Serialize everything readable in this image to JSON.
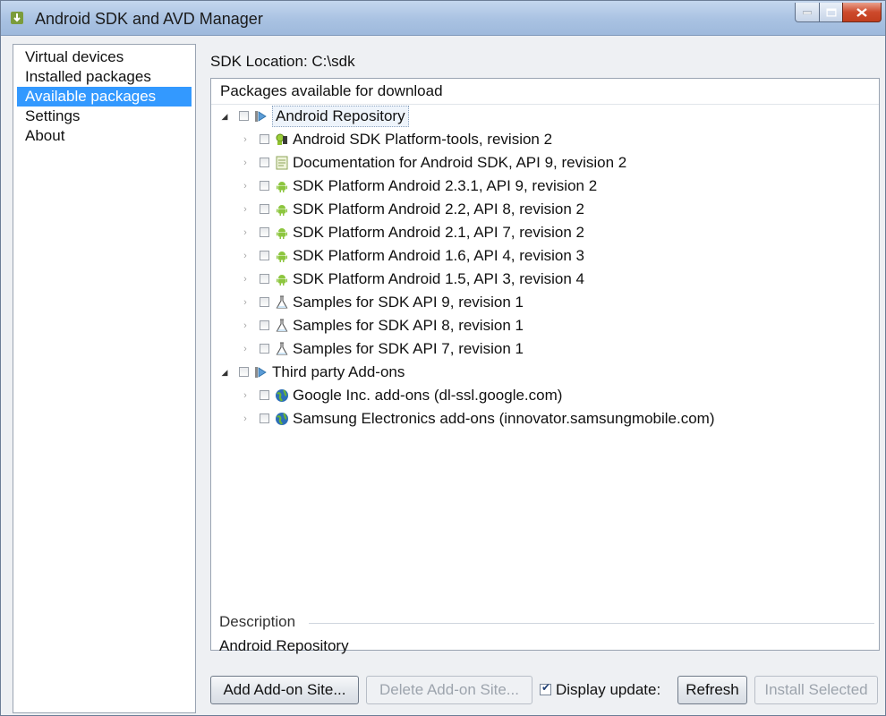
{
  "window": {
    "title": "Android SDK and AVD Manager"
  },
  "nav": {
    "items": [
      {
        "label": "Virtual devices",
        "active": false
      },
      {
        "label": "Installed packages",
        "active": false
      },
      {
        "label": "Available packages",
        "active": true
      },
      {
        "label": "Settings",
        "active": false
      },
      {
        "label": "About",
        "active": false
      }
    ]
  },
  "main": {
    "sdk_location": "SDK Location: C:\\sdk",
    "packages_header": "Packages available for download",
    "tree": [
      {
        "level": 0,
        "expanded": true,
        "icon": "repository-icon",
        "label": "Android Repository",
        "selected": true
      },
      {
        "level": 1,
        "icon": "platform-tools-icon",
        "label": "Android SDK Platform-tools, revision 2"
      },
      {
        "level": 1,
        "icon": "documentation-icon",
        "label": "Documentation for Android SDK, API 9, revision 2"
      },
      {
        "level": 1,
        "icon": "android-icon",
        "label": "SDK Platform Android 2.3.1, API 9, revision 2"
      },
      {
        "level": 1,
        "icon": "android-icon",
        "label": "SDK Platform Android 2.2, API 8, revision 2"
      },
      {
        "level": 1,
        "icon": "android-icon",
        "label": "SDK Platform Android 2.1, API 7, revision 2"
      },
      {
        "level": 1,
        "icon": "android-icon",
        "label": "SDK Platform Android 1.6, API 4, revision 3"
      },
      {
        "level": 1,
        "icon": "android-icon",
        "label": "SDK Platform Android 1.5, API 3, revision 4"
      },
      {
        "level": 1,
        "icon": "samples-flask-icon",
        "label": "Samples for SDK API 9, revision 1"
      },
      {
        "level": 1,
        "icon": "samples-flask-icon",
        "label": "Samples for SDK API 8, revision 1"
      },
      {
        "level": 1,
        "icon": "samples-flask-icon",
        "label": "Samples for SDK API 7, revision 1"
      },
      {
        "level": 0,
        "expanded": true,
        "icon": "repository-icon",
        "label": "Third party Add-ons",
        "selected": false
      },
      {
        "level": 1,
        "icon": "globe-icon",
        "label": "Google Inc. add-ons (dl-ssl.google.com)"
      },
      {
        "level": 1,
        "icon": "globe-icon",
        "label": "Samsung Electronics add-ons (innovator.samsungmobile.com)"
      }
    ],
    "description_title": "Description",
    "description_text": "Android Repository"
  },
  "buttons": {
    "add_site": "Add Add-on Site...",
    "delete_site": "Delete Add-on Site...",
    "display_updates": "Display update:",
    "display_updates_checked": true,
    "refresh": "Refresh",
    "install_selected": "Install Selected"
  },
  "colors": {
    "selection": "#3399ff",
    "title_bar": "#a9c2e2",
    "close_button": "#cd4a2c"
  }
}
